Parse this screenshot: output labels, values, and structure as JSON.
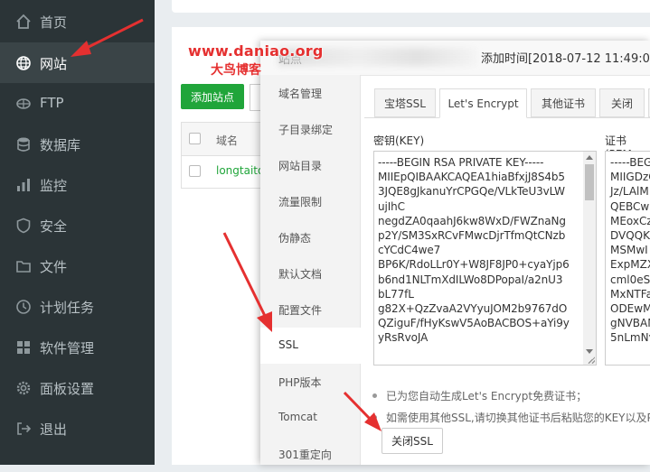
{
  "sidebar": {
    "items": [
      {
        "label": "首页",
        "icon": "home-icon"
      },
      {
        "label": "网站",
        "icon": "globe-icon",
        "active": true
      },
      {
        "label": "FTP",
        "icon": "ftp-icon"
      },
      {
        "label": "数据库",
        "icon": "database-icon"
      },
      {
        "label": "监控",
        "icon": "monitor-icon"
      },
      {
        "label": "安全",
        "icon": "shield-icon"
      },
      {
        "label": "文件",
        "icon": "folder-icon"
      },
      {
        "label": "计划任务",
        "icon": "clock-icon"
      },
      {
        "label": "软件管理",
        "icon": "apps-icon"
      },
      {
        "label": "面板设置",
        "icon": "gear-icon"
      },
      {
        "label": "退出",
        "icon": "logout-icon"
      }
    ]
  },
  "main": {
    "add_site_label": "添加站点",
    "table": {
      "header_domain": "域名",
      "row_link": "longtaito"
    }
  },
  "dialog": {
    "title_prefix": "站点",
    "title_time": "添加时间[2018-07-12 11:49:0",
    "menu": [
      "域名管理",
      "子目录绑定",
      "网站目录",
      "流量限制",
      "伪静态",
      "默认文档",
      "配置文件",
      "SSL",
      "PHP版本",
      "Tomcat",
      "301重定向"
    ],
    "active_menu": "SSL",
    "ssl_tabs": [
      "宝塔SSL",
      "Let's Encrypt",
      "其他证书",
      "关闭"
    ],
    "active_tab": "Let's Encrypt",
    "key_label": "密钥(KEY)",
    "cert_label": "证书(PEM",
    "key_lines": [
      "-----BEGIN RSA PRIVATE KEY-----",
      "MIIEpQIBAAKCAQEA1hiaBfxjJ8S4b5",
      "3JQE8gJkanuYrCPGQe/VLkTeU3vLW",
      "ujIhC",
      "negdZA0qaahJ6kw8WxD/FWZnaNg",
      "p2Y/SM3SxRCvFMwcDjrTfmQtCNzb",
      "cYCdC4we7",
      "BP6K/RdoLLr0Y+W8JF8JP0+cyaYjp6",
      "b6nd1NLTmXdILWo8DPopaI/a2nU3",
      "bL77fL",
      "g82X+QzZvaA2VYyuJOM2b9767dO",
      "QZiguF/fHyKswV5AoBACBOS+aYi9y",
      "yRsRvoJA"
    ],
    "cert_lines": [
      "-----BEG",
      "MIIGDzC",
      "Jz/LAlM",
      "QEBCwU",
      "MEoxCz",
      "DVQQK",
      "MSMwI",
      "ExpMZX",
      "cml0eSE",
      "MxNTFa",
      "ODEwM",
      "gNVBAM",
      "5nLmNv"
    ],
    "notes": [
      "已为您自动生成Let's Encrypt免费证书；",
      "如需使用其他SSL,请切换其他证书后粘贴您的KEY以及P"
    ],
    "close_ssl_label": "关闭SSL"
  },
  "watermark": {
    "url": "www.daniao.org",
    "name": "大鸟博客"
  },
  "colors": {
    "sidebar_bg": "#2b3437",
    "accent_green": "#20a53a",
    "annotation_red": "#e53030"
  }
}
